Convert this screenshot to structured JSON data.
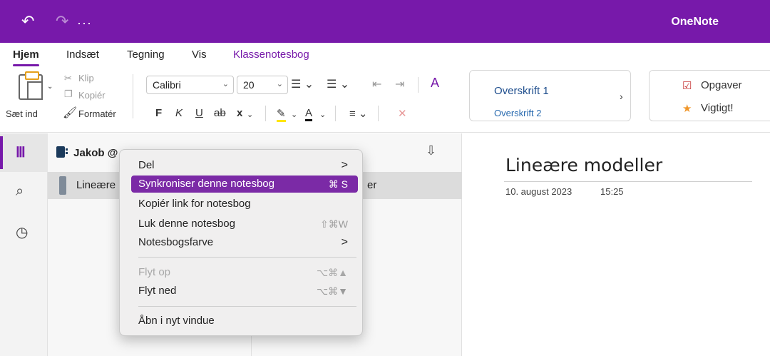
{
  "titlebar": {
    "undo_icon": "undo-icon",
    "redo_icon": "redo-icon",
    "more": "···",
    "app_name": "OneNote",
    "bg_color": "#7719aa"
  },
  "tabs": [
    {
      "label": "Hjem"
    },
    {
      "label": "Indsæt"
    },
    {
      "label": "Tegning"
    },
    {
      "label": "Vis"
    },
    {
      "label": "Klassenotesbog"
    }
  ],
  "ribbon": {
    "paste": "Sæt ind",
    "cut": "Klip",
    "copy": "Kopiér",
    "format_painter": "Formatér",
    "font_name": "Calibri",
    "font_size": "20",
    "bold": "F",
    "italic": "K",
    "underline": "U",
    "strikethrough": "ab",
    "subscript": "x",
    "styles": {
      "heading1": "Overskrift 1",
      "heading2": "Overskrift 2"
    },
    "tags": {
      "todo": "Opgaver",
      "important": "Vigtigt!"
    }
  },
  "notebook": {
    "name": "Jakob @",
    "section": "Lineære",
    "section_suffix": "er"
  },
  "page": {
    "title": "Lineære modeller",
    "date": "10. august 2023",
    "time": "15:25"
  },
  "context_menu": {
    "items": [
      {
        "label": "Del",
        "submenu": ">"
      },
      {
        "label": "Synkroniser denne notesbog",
        "shortcut": "⌘ S"
      },
      {
        "label": "Kopiér link for notesbog"
      },
      {
        "label": "Luk denne notesbog",
        "shortcut": "⇧⌘W"
      },
      {
        "label": "Notesbogsfarve",
        "submenu": ">"
      },
      {
        "label": "Flyt op",
        "shortcut": "⌥⌘▲"
      },
      {
        "label": "Flyt ned",
        "shortcut": "⌥⌘▼"
      },
      {
        "label": "Åbn i nyt vindue"
      }
    ]
  }
}
